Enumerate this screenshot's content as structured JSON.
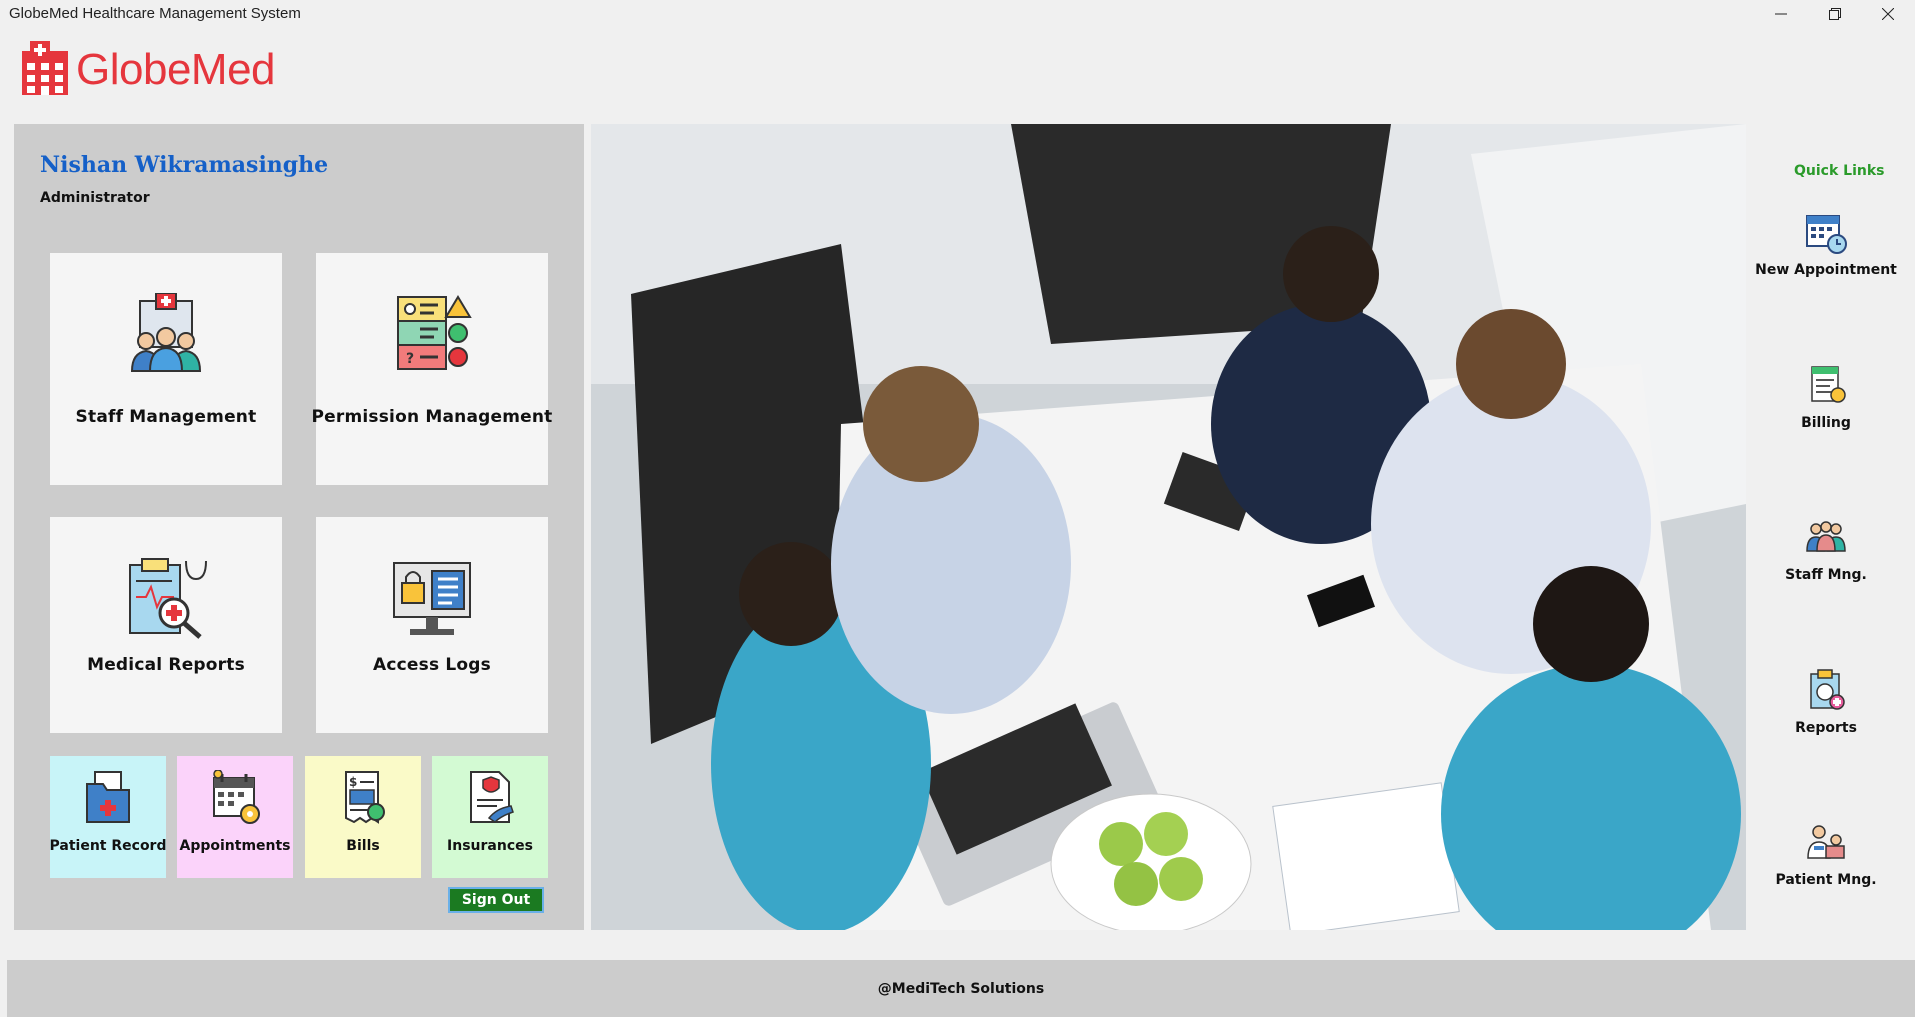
{
  "window": {
    "title": "GlobeMed Healthcare Management System",
    "controls": [
      "minimize-icon",
      "restore-icon",
      "close-icon"
    ]
  },
  "logo": {
    "text": "GlobeMed",
    "color": "#e5363d"
  },
  "user": {
    "name": "Nishan Wikramasinghe",
    "role": "Administrator",
    "name_color": "#1560c8"
  },
  "tiles": [
    {
      "label": "Staff Management",
      "icon": "staff-group-icon"
    },
    {
      "label": "Permission Management",
      "icon": "permission-checklist-icon"
    },
    {
      "label": "Medical Reports",
      "icon": "medical-report-icon"
    },
    {
      "label": "Access Logs",
      "icon": "access-log-monitor-icon"
    }
  ],
  "mini_tiles": [
    {
      "label": "Patient Record",
      "icon": "patient-folder-icon",
      "bg": "#c8f4f8"
    },
    {
      "label": "Appointments",
      "icon": "calendar-gear-icon",
      "bg": "#fbd3fa"
    },
    {
      "label": "Bills",
      "icon": "bill-receipt-icon",
      "bg": "#fafac8"
    },
    {
      "label": "Insurances",
      "icon": "insurance-document-icon",
      "bg": "#d3fad3"
    }
  ],
  "signout_label": "Sign Out",
  "quick_links": {
    "title": "Quick Links",
    "items": [
      {
        "label": "New Appointment",
        "icon": "calendar-clock-icon"
      },
      {
        "label": "Billing",
        "icon": "billing-icon"
      },
      {
        "label": "Staff Mng.",
        "icon": "staff-icon"
      },
      {
        "label": "Reports",
        "icon": "reports-clipboard-icon"
      },
      {
        "label": "Patient Mng.",
        "icon": "patient-doctor-icon"
      }
    ]
  },
  "footer": {
    "text": "@MediTech Solutions"
  },
  "colors": {
    "accent_green": "#2b9b2b",
    "signout_bg": "#1b7a21",
    "panel_bg": "#cccccc"
  }
}
